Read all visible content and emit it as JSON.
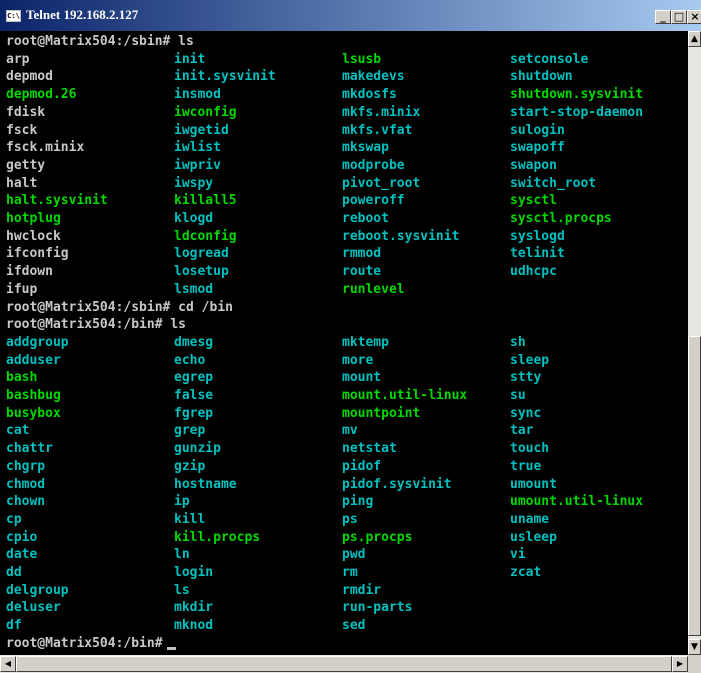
{
  "window": {
    "title": "Telnet 192.168.2.127",
    "icon_label": "C:\\",
    "buttons": {
      "minimize": "_",
      "maximize": "□",
      "close": "×"
    }
  },
  "colors": {
    "background": "#000000",
    "command_text": "#c8c8c8",
    "directory_and_device": "#00c0c0",
    "symlink": "#00d800",
    "titlebar_start": "#0a246a",
    "titlebar_end": "#a6caf0"
  },
  "terminal": {
    "lines": [
      {
        "type": "prompt",
        "text": "root@Matrix504:/sbin# ls"
      },
      {
        "type": "row",
        "cells": [
          {
            "text": "arp",
            "color": "w"
          },
          {
            "text": "init",
            "color": "c"
          },
          {
            "text": "lsusb",
            "color": "g"
          },
          {
            "text": "setconsole",
            "color": "c"
          }
        ]
      },
      {
        "type": "row",
        "cells": [
          {
            "text": "depmod",
            "color": "w"
          },
          {
            "text": "init.sysvinit",
            "color": "c"
          },
          {
            "text": "makedevs",
            "color": "c"
          },
          {
            "text": "shutdown",
            "color": "c"
          }
        ]
      },
      {
        "type": "row",
        "cells": [
          {
            "text": "depmod.26",
            "color": "g"
          },
          {
            "text": "insmod",
            "color": "c"
          },
          {
            "text": "mkdosfs",
            "color": "c"
          },
          {
            "text": "shutdown.sysvinit",
            "color": "g"
          }
        ]
      },
      {
        "type": "row",
        "cells": [
          {
            "text": "fdisk",
            "color": "w"
          },
          {
            "text": "iwconfig",
            "color": "g"
          },
          {
            "text": "mkfs.minix",
            "color": "c"
          },
          {
            "text": "start-stop-daemon",
            "color": "c"
          }
        ]
      },
      {
        "type": "row",
        "cells": [
          {
            "text": "fsck",
            "color": "w"
          },
          {
            "text": "iwgetid",
            "color": "c"
          },
          {
            "text": "mkfs.vfat",
            "color": "c"
          },
          {
            "text": "sulogin",
            "color": "c"
          }
        ]
      },
      {
        "type": "row",
        "cells": [
          {
            "text": "fsck.minix",
            "color": "w"
          },
          {
            "text": "iwlist",
            "color": "c"
          },
          {
            "text": "mkswap",
            "color": "c"
          },
          {
            "text": "swapoff",
            "color": "c"
          }
        ]
      },
      {
        "type": "row",
        "cells": [
          {
            "text": "getty",
            "color": "w"
          },
          {
            "text": "iwpriv",
            "color": "c"
          },
          {
            "text": "modprobe",
            "color": "c"
          },
          {
            "text": "swapon",
            "color": "c"
          }
        ]
      },
      {
        "type": "row",
        "cells": [
          {
            "text": "halt",
            "color": "w"
          },
          {
            "text": "iwspy",
            "color": "c"
          },
          {
            "text": "pivot_root",
            "color": "c"
          },
          {
            "text": "switch_root",
            "color": "c"
          }
        ]
      },
      {
        "type": "row",
        "cells": [
          {
            "text": "halt.sysvinit",
            "color": "g"
          },
          {
            "text": "killall5",
            "color": "g"
          },
          {
            "text": "poweroff",
            "color": "c"
          },
          {
            "text": "sysctl",
            "color": "g"
          }
        ]
      },
      {
        "type": "row",
        "cells": [
          {
            "text": "hotplug",
            "color": "g"
          },
          {
            "text": "klogd",
            "color": "c"
          },
          {
            "text": "reboot",
            "color": "c"
          },
          {
            "text": "sysctl.procps",
            "color": "g"
          }
        ]
      },
      {
        "type": "row",
        "cells": [
          {
            "text": "hwclock",
            "color": "w"
          },
          {
            "text": "ldconfig",
            "color": "g"
          },
          {
            "text": "reboot.sysvinit",
            "color": "c"
          },
          {
            "text": "syslogd",
            "color": "c"
          }
        ]
      },
      {
        "type": "row",
        "cells": [
          {
            "text": "ifconfig",
            "color": "w"
          },
          {
            "text": "logread",
            "color": "c"
          },
          {
            "text": "rmmod",
            "color": "c"
          },
          {
            "text": "telinit",
            "color": "c"
          }
        ]
      },
      {
        "type": "row",
        "cells": [
          {
            "text": "ifdown",
            "color": "w"
          },
          {
            "text": "losetup",
            "color": "c"
          },
          {
            "text": "route",
            "color": "c"
          },
          {
            "text": "udhcpc",
            "color": "c"
          }
        ]
      },
      {
        "type": "row",
        "cells": [
          {
            "text": "ifup",
            "color": "w"
          },
          {
            "text": "lsmod",
            "color": "c"
          },
          {
            "text": "runlevel",
            "color": "g"
          },
          {
            "text": "",
            "color": "w"
          }
        ]
      },
      {
        "type": "prompt",
        "text": "root@Matrix504:/sbin# cd /bin"
      },
      {
        "type": "prompt",
        "text": "root@Matrix504:/bin# ls"
      },
      {
        "type": "row",
        "cells": [
          {
            "text": "addgroup",
            "color": "c"
          },
          {
            "text": "dmesg",
            "color": "c"
          },
          {
            "text": "mktemp",
            "color": "c"
          },
          {
            "text": "sh",
            "color": "c"
          }
        ]
      },
      {
        "type": "row",
        "cells": [
          {
            "text": "adduser",
            "color": "c"
          },
          {
            "text": "echo",
            "color": "c"
          },
          {
            "text": "more",
            "color": "c"
          },
          {
            "text": "sleep",
            "color": "c"
          }
        ]
      },
      {
        "type": "row",
        "cells": [
          {
            "text": "bash",
            "color": "g"
          },
          {
            "text": "egrep",
            "color": "c"
          },
          {
            "text": "mount",
            "color": "c"
          },
          {
            "text": "stty",
            "color": "c"
          }
        ]
      },
      {
        "type": "row",
        "cells": [
          {
            "text": "bashbug",
            "color": "g"
          },
          {
            "text": "false",
            "color": "c"
          },
          {
            "text": "mount.util-linux",
            "color": "g"
          },
          {
            "text": "su",
            "color": "c"
          }
        ]
      },
      {
        "type": "row",
        "cells": [
          {
            "text": "busybox",
            "color": "g"
          },
          {
            "text": "fgrep",
            "color": "c"
          },
          {
            "text": "mountpoint",
            "color": "g"
          },
          {
            "text": "sync",
            "color": "c"
          }
        ]
      },
      {
        "type": "row",
        "cells": [
          {
            "text": "cat",
            "color": "c"
          },
          {
            "text": "grep",
            "color": "c"
          },
          {
            "text": "mv",
            "color": "c"
          },
          {
            "text": "tar",
            "color": "c"
          }
        ]
      },
      {
        "type": "row",
        "cells": [
          {
            "text": "chattr",
            "color": "c"
          },
          {
            "text": "gunzip",
            "color": "c"
          },
          {
            "text": "netstat",
            "color": "c"
          },
          {
            "text": "touch",
            "color": "c"
          }
        ]
      },
      {
        "type": "row",
        "cells": [
          {
            "text": "chgrp",
            "color": "c"
          },
          {
            "text": "gzip",
            "color": "c"
          },
          {
            "text": "pidof",
            "color": "c"
          },
          {
            "text": "true",
            "color": "c"
          }
        ]
      },
      {
        "type": "row",
        "cells": [
          {
            "text": "chmod",
            "color": "c"
          },
          {
            "text": "hostname",
            "color": "c"
          },
          {
            "text": "pidof.sysvinit",
            "color": "c"
          },
          {
            "text": "umount",
            "color": "c"
          }
        ]
      },
      {
        "type": "row",
        "cells": [
          {
            "text": "chown",
            "color": "c"
          },
          {
            "text": "ip",
            "color": "c"
          },
          {
            "text": "ping",
            "color": "c"
          },
          {
            "text": "umount.util-linux",
            "color": "g"
          }
        ]
      },
      {
        "type": "row",
        "cells": [
          {
            "text": "cp",
            "color": "c"
          },
          {
            "text": "kill",
            "color": "c"
          },
          {
            "text": "ps",
            "color": "c"
          },
          {
            "text": "uname",
            "color": "c"
          }
        ]
      },
      {
        "type": "row",
        "cells": [
          {
            "text": "cpio",
            "color": "c"
          },
          {
            "text": "kill.procps",
            "color": "g"
          },
          {
            "text": "ps.procps",
            "color": "g"
          },
          {
            "text": "usleep",
            "color": "c"
          }
        ]
      },
      {
        "type": "row",
        "cells": [
          {
            "text": "date",
            "color": "c"
          },
          {
            "text": "ln",
            "color": "c"
          },
          {
            "text": "pwd",
            "color": "c"
          },
          {
            "text": "vi",
            "color": "c"
          }
        ]
      },
      {
        "type": "row",
        "cells": [
          {
            "text": "dd",
            "color": "c"
          },
          {
            "text": "login",
            "color": "c"
          },
          {
            "text": "rm",
            "color": "c"
          },
          {
            "text": "zcat",
            "color": "c"
          }
        ]
      },
      {
        "type": "row",
        "cells": [
          {
            "text": "delgroup",
            "color": "c"
          },
          {
            "text": "ls",
            "color": "c"
          },
          {
            "text": "rmdir",
            "color": "c"
          },
          {
            "text": "",
            "color": "c"
          }
        ]
      },
      {
        "type": "row",
        "cells": [
          {
            "text": "deluser",
            "color": "c"
          },
          {
            "text": "mkdir",
            "color": "c"
          },
          {
            "text": "run-parts",
            "color": "c"
          },
          {
            "text": "",
            "color": "c"
          }
        ]
      },
      {
        "type": "row",
        "cells": [
          {
            "text": "df",
            "color": "c"
          },
          {
            "text": "mknod",
            "color": "c"
          },
          {
            "text": "sed",
            "color": "c"
          },
          {
            "text": "",
            "color": "c"
          }
        ]
      },
      {
        "type": "prompt",
        "text": "root@Matrix504:/bin#",
        "cursor": true
      }
    ]
  },
  "scrollbars": {
    "up_arrow": "▲",
    "down_arrow": "▼",
    "left_arrow": "◀",
    "right_arrow": "▶"
  }
}
